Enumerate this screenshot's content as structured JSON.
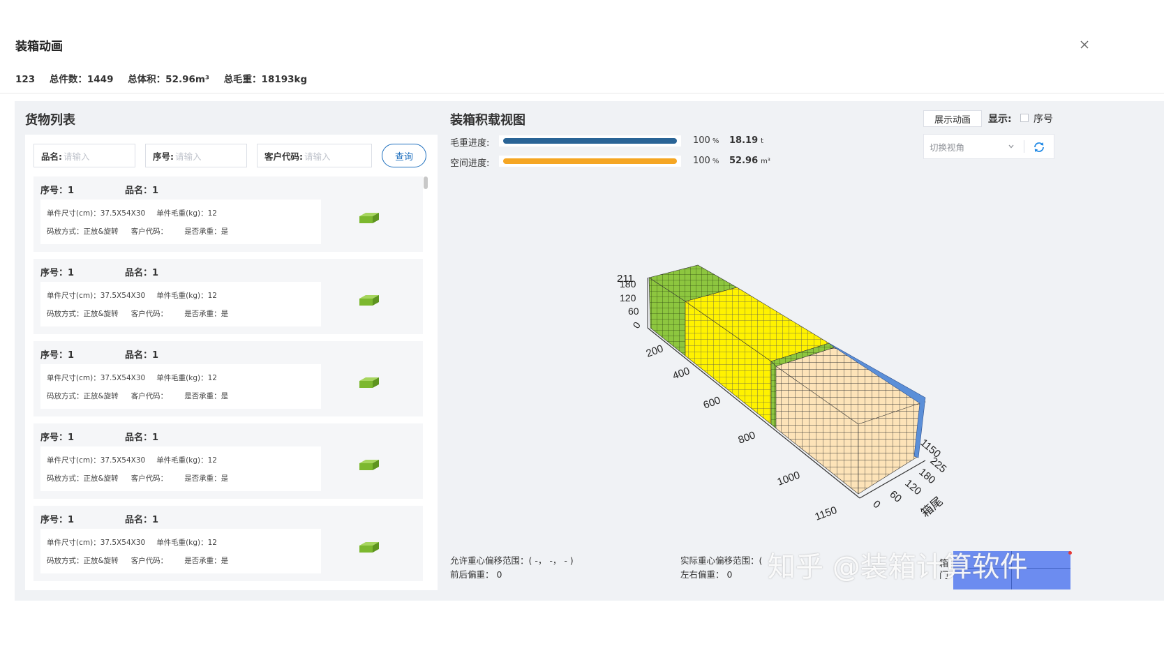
{
  "dialog": {
    "title": "装箱动画"
  },
  "summary": {
    "id": "123",
    "total_count": "总件数：1449",
    "total_volume": "总体积：52.96m³",
    "total_weight": "总毛重：18193kg"
  },
  "cargo_list": {
    "title": "货物列表",
    "filters": [
      {
        "label": "品名:",
        "placeholder": "请输入"
      },
      {
        "label": "序号:",
        "placeholder": "请输入"
      },
      {
        "label": "客户代码:",
        "placeholder": "请输入"
      }
    ],
    "query_label": "查询",
    "items": [
      {
        "seq": "序号：1",
        "name": "品名：1",
        "size": "单件尺寸(cm)：37.5X54X30",
        "weight": "单件毛重(kg)：12",
        "stack": "码放方式：正放&旋转",
        "customer": "客户代码：",
        "bearing": "是否承重：是"
      },
      {
        "seq": "序号：1",
        "name": "品名：1",
        "size": "单件尺寸(cm)：37.5X54X30",
        "weight": "单件毛重(kg)：12",
        "stack": "码放方式：正放&旋转",
        "customer": "客户代码：",
        "bearing": "是否承重：是"
      },
      {
        "seq": "序号：1",
        "name": "品名：1",
        "size": "单件尺寸(cm)：37.5X54X30",
        "weight": "单件毛重(kg)：12",
        "stack": "码放方式：正放&旋转",
        "customer": "客户代码：",
        "bearing": "是否承重：是"
      },
      {
        "seq": "序号：1",
        "name": "品名：1",
        "size": "单件尺寸(cm)：37.5X54X30",
        "weight": "单件毛重(kg)：12",
        "stack": "码放方式：正放&旋转",
        "customer": "客户代码：",
        "bearing": "是否承重：是"
      },
      {
        "seq": "序号：1",
        "name": "品名：1",
        "size": "单件尺寸(cm)：37.5X54X30",
        "weight": "单件毛重(kg)：12",
        "stack": "码放方式：正放&旋转",
        "customer": "客户代码：",
        "bearing": "是否承重：是"
      }
    ]
  },
  "load_view": {
    "title": "装箱积载视图",
    "weight_progress": {
      "label": "毛重进度:",
      "percent": 100,
      "percent_text": "100",
      "value": "18.19",
      "unit": "t",
      "color": "#2a6496"
    },
    "space_progress": {
      "label": "空间进度:",
      "percent": 100,
      "percent_text": "100",
      "value": "52.96",
      "unit": "m³",
      "color": "#f5a623"
    },
    "percent_unit": "%",
    "show_animation_label": "展示动画",
    "display_label": "显示:",
    "seq_checkbox_label": "序号",
    "view_select_placeholder": "切换视角",
    "axis": {
      "height_ticks": [
        "211",
        "180",
        "120",
        "60",
        "0"
      ],
      "length_ticks": [
        "200",
        "400",
        "600",
        "800",
        "1000",
        "1150"
      ],
      "width_ticks": [
        "0",
        "60",
        "120",
        "180",
        "225"
      ],
      "far_tick": "1150",
      "rear_label": "箱尾",
      "door_label": "箱门"
    },
    "cargo_colors": {
      "green": "#8dc63f",
      "yellow": "#fff200",
      "beige": "#fde3b8",
      "blue": "#5b8fd8"
    },
    "allowed_cg_range": "允许重心偏移范围：( -， -， - )",
    "front_rear_offset": "前后偏重：  0",
    "actual_cg_range": "实际重心偏移范围：(",
    "left_right_offset": "左右偏重：  0"
  },
  "watermark": "知乎 @装箱计算软件"
}
